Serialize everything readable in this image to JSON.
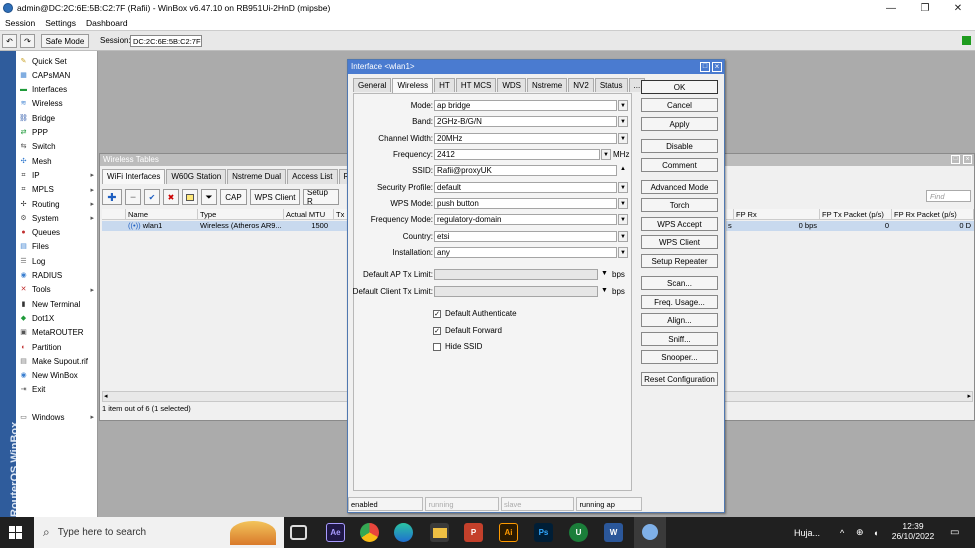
{
  "window": {
    "title": "admin@DC:2C:6E:5B:C2:7F (Rafii) - WinBox v6.47.10 on RB951Ui-2HnD (mipsbe)"
  },
  "menu": [
    "Session",
    "Settings",
    "Dashboard"
  ],
  "toolbar": {
    "safe_mode": "Safe Mode",
    "session_label": "Session:",
    "session_value": "DC:2C:6E:5B:C2:7F"
  },
  "brand": "RouterOS WinBox",
  "sidebar": {
    "items": [
      {
        "label": "Quick Set",
        "icon": "quickset-icon",
        "sub": false,
        "color": "#c9a227"
      },
      {
        "label": "CAPsMAN",
        "icon": "capsman-icon",
        "sub": false,
        "color": "#3a7fd0"
      },
      {
        "label": "Interfaces",
        "icon": "interfaces-icon",
        "sub": false,
        "color": "#1f9a3a"
      },
      {
        "label": "Wireless",
        "icon": "wireless-icon",
        "sub": false,
        "color": "#3a7fd0"
      },
      {
        "label": "Bridge",
        "icon": "bridge-icon",
        "sub": false,
        "color": "#2a56a8"
      },
      {
        "label": "PPP",
        "icon": "ppp-icon",
        "sub": false,
        "color": "#1f9a3a"
      },
      {
        "label": "Switch",
        "icon": "switch-icon",
        "sub": false,
        "color": "#555555"
      },
      {
        "label": "Mesh",
        "icon": "mesh-icon",
        "sub": false,
        "color": "#3a7fd0"
      },
      {
        "label": "IP",
        "icon": "ip-icon",
        "sub": true,
        "color": "#333333"
      },
      {
        "label": "MPLS",
        "icon": "mpls-icon",
        "sub": true,
        "color": "#333333"
      },
      {
        "label": "Routing",
        "icon": "routing-icon",
        "sub": true,
        "color": "#333333"
      },
      {
        "label": "System",
        "icon": "system-icon",
        "sub": true,
        "color": "#555555"
      },
      {
        "label": "Queues",
        "icon": "queues-icon",
        "sub": false,
        "color": "#c03030"
      },
      {
        "label": "Files",
        "icon": "files-icon",
        "sub": false,
        "color": "#3a7fd0"
      },
      {
        "label": "Log",
        "icon": "log-icon",
        "sub": false,
        "color": "#777777"
      },
      {
        "label": "RADIUS",
        "icon": "radius-icon",
        "sub": false,
        "color": "#3a7fd0"
      },
      {
        "label": "Tools",
        "icon": "tools-icon",
        "sub": true,
        "color": "#c03030"
      },
      {
        "label": "New Terminal",
        "icon": "terminal-icon",
        "sub": false,
        "color": "#333333"
      },
      {
        "label": "Dot1X",
        "icon": "dot1x-icon",
        "sub": false,
        "color": "#1f9a3a"
      },
      {
        "label": "MetaROUTER",
        "icon": "metarouter-icon",
        "sub": false,
        "color": "#555555"
      },
      {
        "label": "Partition",
        "icon": "partition-icon",
        "sub": false,
        "color": "#c03030"
      },
      {
        "label": "Make Supout.rif",
        "icon": "supout-icon",
        "sub": false,
        "color": "#777777"
      },
      {
        "label": "New WinBox",
        "icon": "winbox-icon",
        "sub": false,
        "color": "#3a7fd0"
      },
      {
        "label": "Exit",
        "icon": "exit-icon",
        "sub": false,
        "color": "#555555"
      },
      {
        "label": "Windows",
        "icon": "windows-icon",
        "sub": true,
        "color": "#555555"
      }
    ]
  },
  "wireless_tables": {
    "title": "Wireless Tables",
    "tabs": [
      "WiFi Interfaces",
      "W60G Station",
      "Nstreme Dual",
      "Access List",
      "Regi"
    ],
    "buttons": {
      "cap": "CAP",
      "wps_client": "WPS Client",
      "setup": "Setup R"
    },
    "find_placeholder": "Find",
    "left_columns": [
      "Name",
      "Type",
      "Actual MTU",
      "Tx"
    ],
    "right_columns": [
      "FP Rx",
      "FP Tx Packet (p/s)",
      "FP Rx Packet (p/s)"
    ],
    "row": {
      "name": "wlan1",
      "type": "Wireless (Atheros AR9...",
      "mtu": "1500",
      "partial": "s",
      "fp_rx": "0 bps",
      "fp_tx_pkt": "0",
      "fp_rx_pkt": "0 D"
    },
    "status": "1 item out of 6 (1 selected)"
  },
  "dialog": {
    "title": "Interface <wlan1>",
    "tabs": [
      "General",
      "Wireless",
      "HT",
      "HT MCS",
      "WDS",
      "Nstreme",
      "NV2",
      "Status",
      "..."
    ],
    "fields": {
      "mode": {
        "label": "Mode:",
        "value": "ap bridge"
      },
      "band": {
        "label": "Band:",
        "value": "2GHz-B/G/N"
      },
      "channel_width": {
        "label": "Channel Width:",
        "value": "20MHz"
      },
      "frequency": {
        "label": "Frequency:",
        "value": "2412",
        "unit": "MHz"
      },
      "ssid": {
        "label": "SSID:",
        "value": "Rafii@proxyUK"
      },
      "security_profile": {
        "label": "Security Profile:",
        "value": "default"
      },
      "wps_mode": {
        "label": "WPS Mode:",
        "value": "push button"
      },
      "frequency_mode": {
        "label": "Frequency Mode:",
        "value": "regulatory-domain"
      },
      "country": {
        "label": "Country:",
        "value": "etsi"
      },
      "installation": {
        "label": "Installation:",
        "value": "any"
      },
      "ap_tx_limit": {
        "label": "Default AP Tx Limit:",
        "value": "",
        "unit": "bps"
      },
      "client_tx_limit": {
        "label": "Default Client Tx Limit:",
        "value": "",
        "unit": "bps"
      }
    },
    "checks": {
      "default_authenticate": {
        "label": "Default Authenticate",
        "checked": true
      },
      "default_forward": {
        "label": "Default Forward",
        "checked": true
      },
      "hide_ssid": {
        "label": "Hide SSID",
        "checked": false
      }
    },
    "buttons": {
      "ok": "OK",
      "cancel": "Cancel",
      "apply": "Apply",
      "disable": "Disable",
      "comment": "Comment",
      "advanced_mode": "Advanced Mode",
      "torch": "Torch",
      "wps_accept": "WPS Accept",
      "wps_client": "WPS Client",
      "setup_repeater": "Setup Repeater",
      "scan": "Scan...",
      "freq_usage": "Freq. Usage...",
      "align": "Align...",
      "sniff": "Sniff...",
      "snooper": "Snooper...",
      "reset": "Reset Configuration"
    },
    "status": [
      "enabled",
      "running",
      "slave",
      "running ap"
    ]
  },
  "taskbar": {
    "search_placeholder": "Type here to search",
    "user": "Huja...",
    "time": "12:39",
    "date": "26/10/2022"
  }
}
